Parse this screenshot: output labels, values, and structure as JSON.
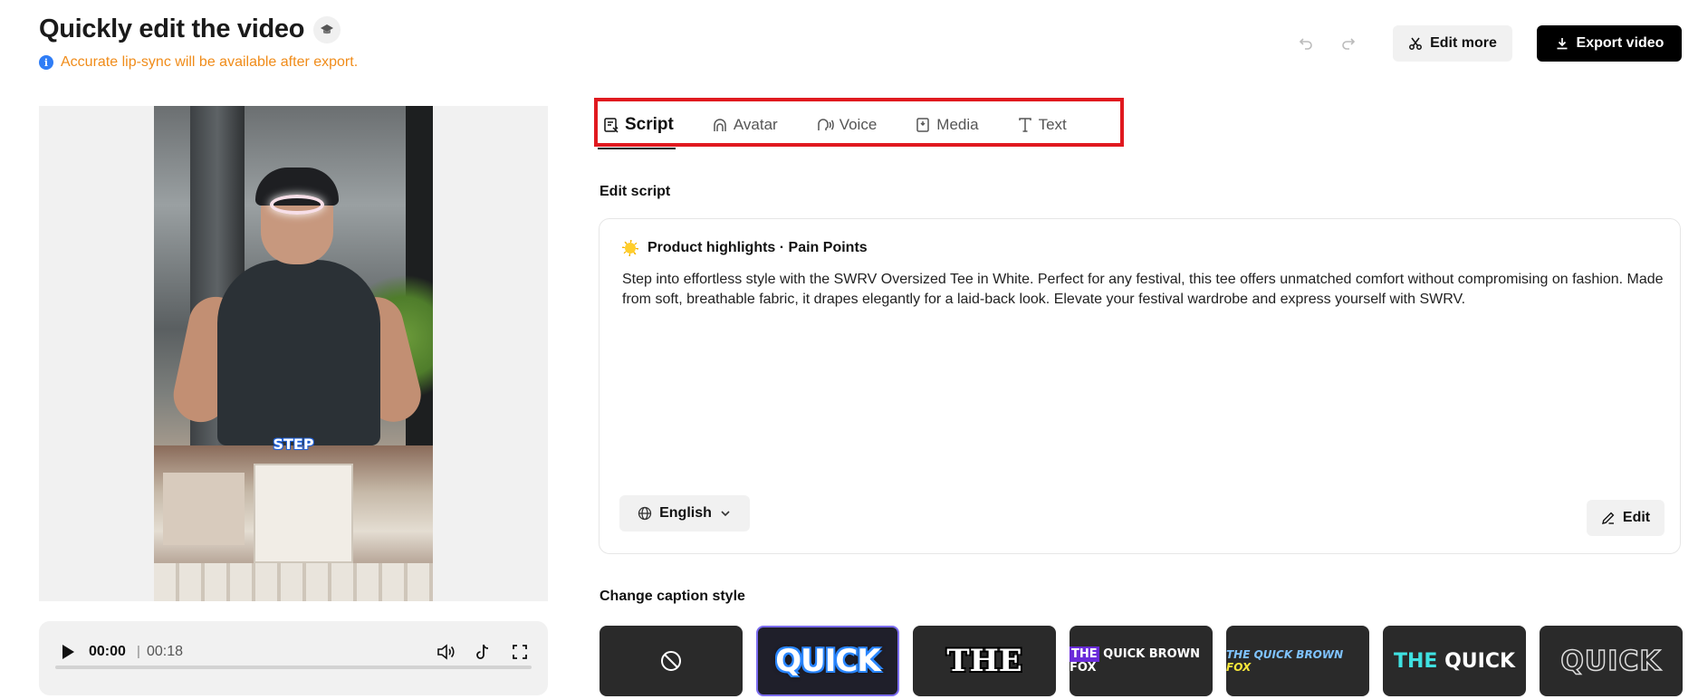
{
  "header": {
    "title": "Quickly edit the video",
    "notice": "Accurate lip-sync will be available after export.",
    "edit_more_label": "Edit more",
    "export_label": "Export video"
  },
  "player": {
    "current_time": "00:00",
    "separator": "|",
    "total_time": "00:18",
    "progress": 0,
    "caption_word": "STEP"
  },
  "tabs": [
    {
      "label": "Script",
      "icon": "script-icon",
      "active": true
    },
    {
      "label": "Avatar",
      "icon": "avatar-icon",
      "active": false
    },
    {
      "label": "Voice",
      "icon": "voice-icon",
      "active": false
    },
    {
      "label": "Media",
      "icon": "media-icon",
      "active": false
    },
    {
      "label": "Text",
      "icon": "text-icon",
      "active": false
    }
  ],
  "script": {
    "section_label": "Edit script",
    "card_title": "Product highlights · Pain Points",
    "body": "Step into effortless style with the SWRV Oversized Tee in White. Perfect for any festival, this tee offers unmatched comfort without compromising on fashion. Made from soft, breathable fabric, it drapes elegantly for a laid-back look. Elevate your festival wardrobe and express yourself with SWRV.",
    "language": "English",
    "edit_label": "Edit"
  },
  "captions": {
    "section_label": "Change caption style",
    "styles": [
      {
        "name": "none",
        "selected": false
      },
      {
        "text": "QUICK",
        "selected": true
      },
      {
        "text": "THE",
        "selected": false
      },
      {
        "highlight": "THE",
        "text": "QUICK BROWN FOX",
        "selected": false
      },
      {
        "text": "THE QUICK BROWN",
        "highlight": "FOX",
        "selected": false
      },
      {
        "highlight": "THE",
        "text": "QUICK",
        "selected": false
      },
      {
        "text": "QUICK",
        "selected": false
      }
    ]
  },
  "colors": {
    "notice": "#f08c1a",
    "info": "#2f7df6",
    "highlight_box": "#e0191f",
    "export_bg": "#000000",
    "selected_tile_border": "#7b6cf0"
  }
}
